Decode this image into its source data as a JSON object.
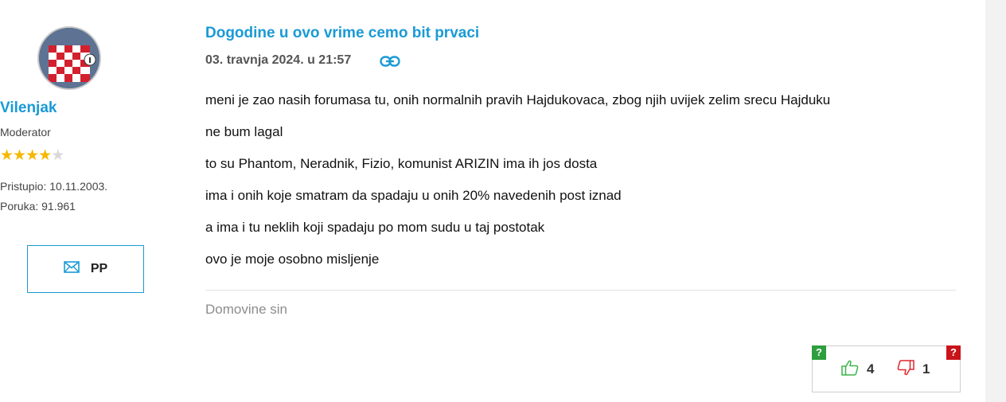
{
  "user": {
    "name": "Vilenjak",
    "role": "Moderator",
    "stars_filled": 4,
    "stars_total": 5,
    "joined": "Pristupio: 10.11.2003.",
    "posts": "Poruka: 91.961",
    "pm_label": "PP"
  },
  "post": {
    "title": "Dogodine u ovo vrime cemo bit prvaci",
    "date": "03. travnja 2024. u 21:57",
    "lines": [
      "meni je zao nasih forumasa tu, onih normalnih pravih Hajdukovaca, zbog njih uvijek zelim srecu Hajduku",
      "ne bum lagal",
      "to su Phantom, Neradnik, Fizio, komunist ARIZIN ima ih jos dosta",
      "ima i onih koje smatram da spadaju u onih 20% navedenih post iznad",
      "a ima i tu neklih koji spadaju po mom sudu u taj postotak",
      "ovo je moje osobno misljenje"
    ],
    "signature": "Domovine sin"
  },
  "votes": {
    "help_up": "?",
    "help_down": "?",
    "up_count": "4",
    "down_count": "1",
    "up_color": "#3cb54a",
    "down_color": "#e0262d"
  },
  "colors": {
    "accent": "#1a9ad6",
    "star": "#f5b800"
  }
}
